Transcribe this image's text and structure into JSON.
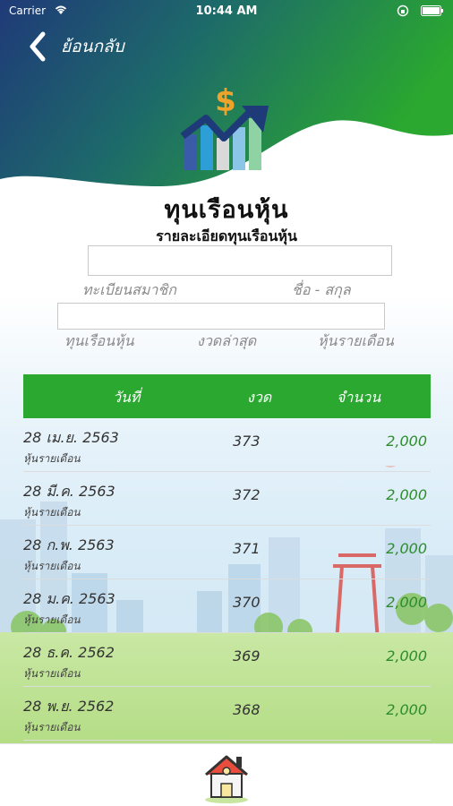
{
  "status_bar": {
    "carrier": "Carrier",
    "time": "10:44 AM"
  },
  "nav": {
    "back_label": "ย้อนกลับ"
  },
  "page": {
    "title": "ทุนเรือนหุ้น",
    "subtitle": "รายละเอียดทุนเรือนหุ้น"
  },
  "form": {
    "member_value": "",
    "shares_value": "",
    "label_member_no": "ทะเบียนสมาชิก",
    "label_name": "ชื่อ - สกุล",
    "label_share_capital": "ทุนเรือนหุ้น",
    "label_latest_period": "งวดล่าสุด",
    "label_monthly_share": "หุ้นรายเดือน"
  },
  "table": {
    "headers": {
      "date": "วันที่",
      "period": "งวด",
      "amount": "จำนวน"
    },
    "rows": [
      {
        "date": "28 เม.ย. 2563",
        "type": "หุ้นรายเดือน",
        "period": "373",
        "amount": "2,000"
      },
      {
        "date": "28 มี.ค. 2563",
        "type": "หุ้นรายเดือน",
        "period": "372",
        "amount": "2,000"
      },
      {
        "date": "28 ก.พ. 2563",
        "type": "หุ้นรายเดือน",
        "period": "371",
        "amount": "2,000"
      },
      {
        "date": "28 ม.ค. 2563",
        "type": "หุ้นรายเดือน",
        "period": "370",
        "amount": "2,000"
      },
      {
        "date": "28 ธ.ค. 2562",
        "type": "หุ้นรายเดือน",
        "period": "369",
        "amount": "2,000"
      },
      {
        "date": "28 พ.ย. 2562",
        "type": "หุ้นรายเดือน",
        "period": "368",
        "amount": "2,000"
      }
    ]
  },
  "icons": {
    "back": "chevron-left-icon",
    "logo": "share-growth-icon",
    "home": "home-icon"
  },
  "colors": {
    "header_dark": "#1f3a78",
    "header_green": "#2aa82f",
    "table_header": "#2aa82f",
    "amount_text": "#2e8b2e"
  }
}
